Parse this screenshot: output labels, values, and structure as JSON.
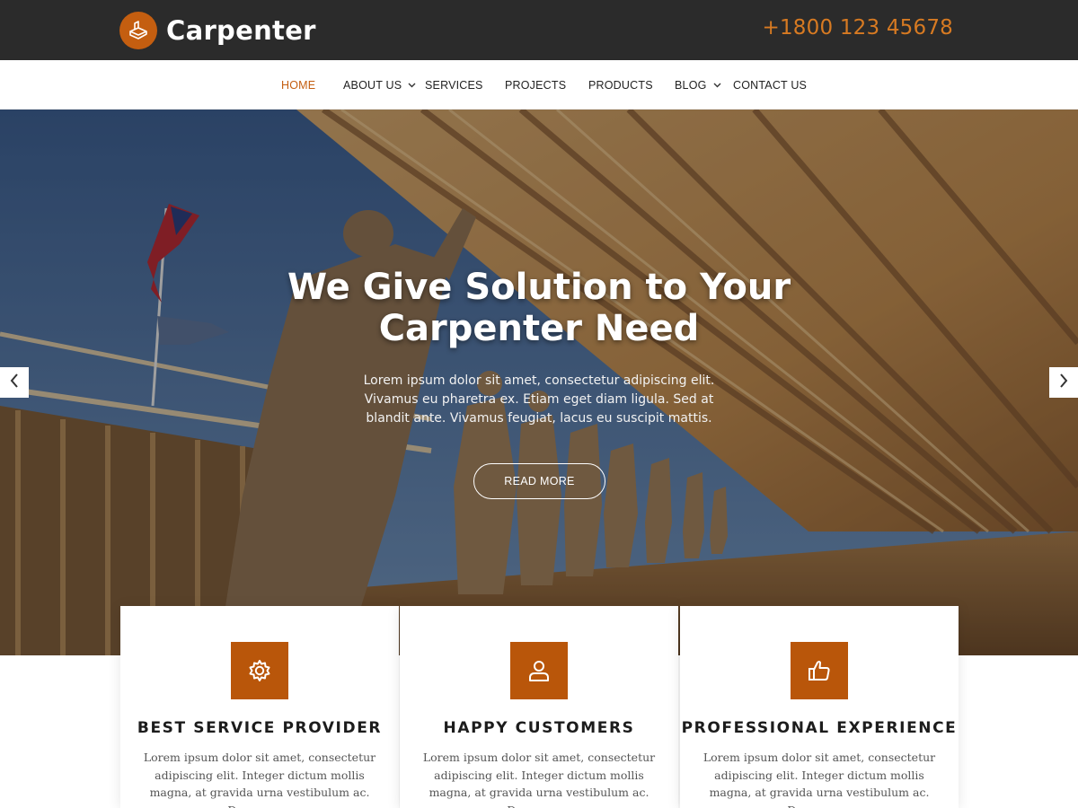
{
  "header": {
    "logo_text": "Carpenter",
    "phone": "+1800 123 45678"
  },
  "nav": {
    "items": [
      {
        "label": "HOME",
        "active": true
      },
      {
        "label": "ABOUT US",
        "dropdown": true
      },
      {
        "label": "SERVICES"
      },
      {
        "label": "PROJECTS"
      },
      {
        "label": "PRODUCTS"
      },
      {
        "label": "BLOG",
        "dropdown": true
      },
      {
        "label": "CONTACT US"
      }
    ]
  },
  "hero": {
    "title": "We Give Solution to Your Carpenter Need",
    "text": "Lorem ipsum dolor sit amet, consectetur adipiscing elit. Vivamus eu pharetra ex. Etiam eget diam ligula. Sed at blandit ante. Vivamus feugiat, lacus eu suscipit mattis.",
    "button_label": "READ MORE",
    "prev_icon": "chevron-left-icon",
    "next_icon": "chevron-right-icon"
  },
  "features": [
    {
      "icon": "gear-icon",
      "title": "BEST SERVICE PROVIDER",
      "text": "Lorem ipsum dolor sit amet, consectetur adipiscing elit. Integer dictum mollis magna, at gravida urna vestibulum ac. Donec eu..."
    },
    {
      "icon": "user-icon",
      "title": "HAPPY CUSTOMERS",
      "text": "Lorem ipsum dolor sit amet, consectetur adipiscing elit. Integer dictum mollis magna, at gravida urna vestibulum ac. Donec eu..."
    },
    {
      "icon": "thumbs-up-icon",
      "title": "PROFESSIONAL EXPERIENCE",
      "text": "Lorem ipsum dolor sit amet, consectetur adipiscing elit. Integer dictum mollis magna, at gravida urna vestibulum ac. Donec eu..."
    }
  ],
  "colors": {
    "accent": "#c45e10",
    "phone": "#d77a22",
    "topbar": "#2b2b2b",
    "icon_box": "#b9560a"
  }
}
